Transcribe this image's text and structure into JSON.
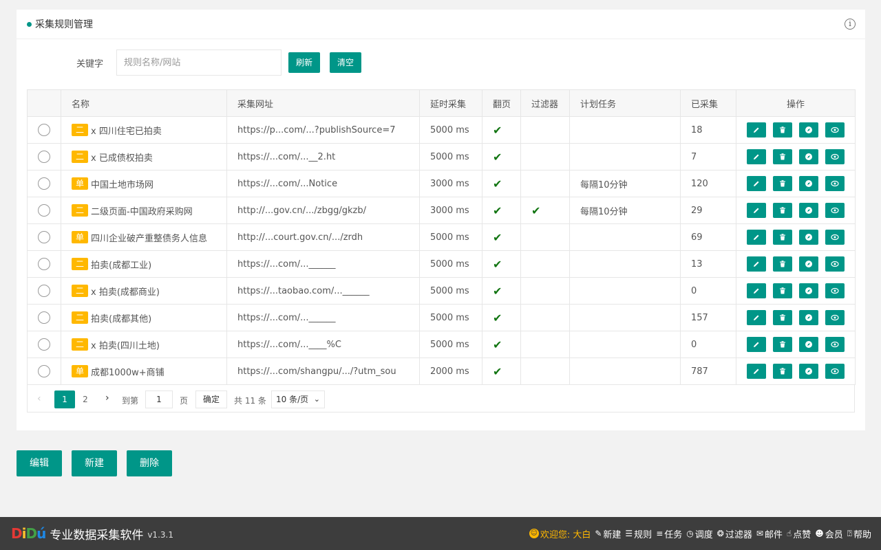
{
  "panel": {
    "title": "采集规则管理",
    "info_icon": "info-circle-icon"
  },
  "search": {
    "label": "关键字",
    "placeholder": "规则名称/网站",
    "value": "",
    "refresh_label": "刷新",
    "clear_label": "清空"
  },
  "table": {
    "headers": [
      "",
      "名称",
      "采集网址",
      "延时采集",
      "翻页",
      "过滤器",
      "计划任务",
      "已采集",
      "操作"
    ],
    "rows": [
      {
        "tag": "二",
        "name": "x 四川住宅已拍卖",
        "url": "https://p...com/...?publishSource=7",
        "delay": "5000 ms",
        "paging": true,
        "filter": false,
        "schedule": "",
        "count": "18"
      },
      {
        "tag": "二",
        "name": "x 已成债权拍卖",
        "url": "https://...com/...__2.ht",
        "delay": "5000 ms",
        "paging": true,
        "filter": false,
        "schedule": "",
        "count": "7"
      },
      {
        "tag": "单",
        "name": "中国土地市场网",
        "url": "https://...com/...Notice",
        "delay": "3000 ms",
        "paging": true,
        "filter": false,
        "schedule": "每隔10分钟",
        "count": "120"
      },
      {
        "tag": "二",
        "name": "二级页面-中国政府采购网",
        "url": "http://...gov.cn/.../zbgg/gkzb/",
        "delay": "3000 ms",
        "paging": true,
        "filter": true,
        "schedule": "每隔10分钟",
        "count": "29"
      },
      {
        "tag": "单",
        "name": "四川企业破产重整债务人信息",
        "url": "http://...court.gov.cn/.../zrdh",
        "delay": "5000 ms",
        "paging": true,
        "filter": false,
        "schedule": "",
        "count": "69"
      },
      {
        "tag": "二",
        "name": "拍卖(成都工业)",
        "url": "https://...com/...______",
        "delay": "5000 ms",
        "paging": true,
        "filter": false,
        "schedule": "",
        "count": "13"
      },
      {
        "tag": "二",
        "name": "x 拍卖(成都商业)",
        "url": "https://...taobao.com/...______",
        "delay": "5000 ms",
        "paging": true,
        "filter": false,
        "schedule": "",
        "count": "0"
      },
      {
        "tag": "二",
        "name": "拍卖(成都其他)",
        "url": "https://...com/...______",
        "delay": "5000 ms",
        "paging": true,
        "filter": false,
        "schedule": "",
        "count": "157"
      },
      {
        "tag": "二",
        "name": "x 拍卖(四川土地)",
        "url": "https://...com/...____%C",
        "delay": "5000 ms",
        "paging": true,
        "filter": false,
        "schedule": "",
        "count": "0"
      },
      {
        "tag": "单",
        "name": "成都1000w+商铺",
        "url": "https://...com/shangpu/.../?utm_sou",
        "delay": "2000 ms",
        "paging": true,
        "filter": false,
        "schedule": "",
        "count": "787"
      }
    ],
    "op_icons": [
      "edit-icon",
      "trash-icon",
      "compass-icon",
      "eye-icon"
    ]
  },
  "pager": {
    "pages": [
      "1",
      "2"
    ],
    "current": "1",
    "goto_label": "到第",
    "goto_value": "1",
    "page_unit": "页",
    "confirm_label": "确定",
    "total_label": "共 11 条",
    "page_size": "10 条/页"
  },
  "actions": {
    "edit_label": "编辑",
    "new_label": "新建",
    "delete_label": "删除"
  },
  "footer": {
    "logo_letters": [
      "D",
      "i",
      "D",
      "ú"
    ],
    "app_name": "专业数据采集软件",
    "version": "v1.3.1",
    "welcome": "欢迎您: 大白",
    "nav": [
      {
        "label": "新建",
        "icon": "pencil-icon"
      },
      {
        "label": "规则",
        "icon": "document-icon"
      },
      {
        "label": "任务",
        "icon": "list-icon"
      },
      {
        "label": "调度",
        "icon": "clock-icon"
      },
      {
        "label": "过滤器",
        "icon": "drops-icon"
      },
      {
        "label": "邮件",
        "icon": "mail-icon"
      },
      {
        "label": "点赞",
        "icon": "thumbs-up-icon"
      },
      {
        "label": "会员",
        "icon": "user-icon"
      },
      {
        "label": "帮助",
        "icon": "help-icon"
      }
    ]
  },
  "colors": {
    "accent": "#009688",
    "tag": "#ffb800",
    "check": "#127512",
    "footer_bg": "#3d3d3d"
  }
}
